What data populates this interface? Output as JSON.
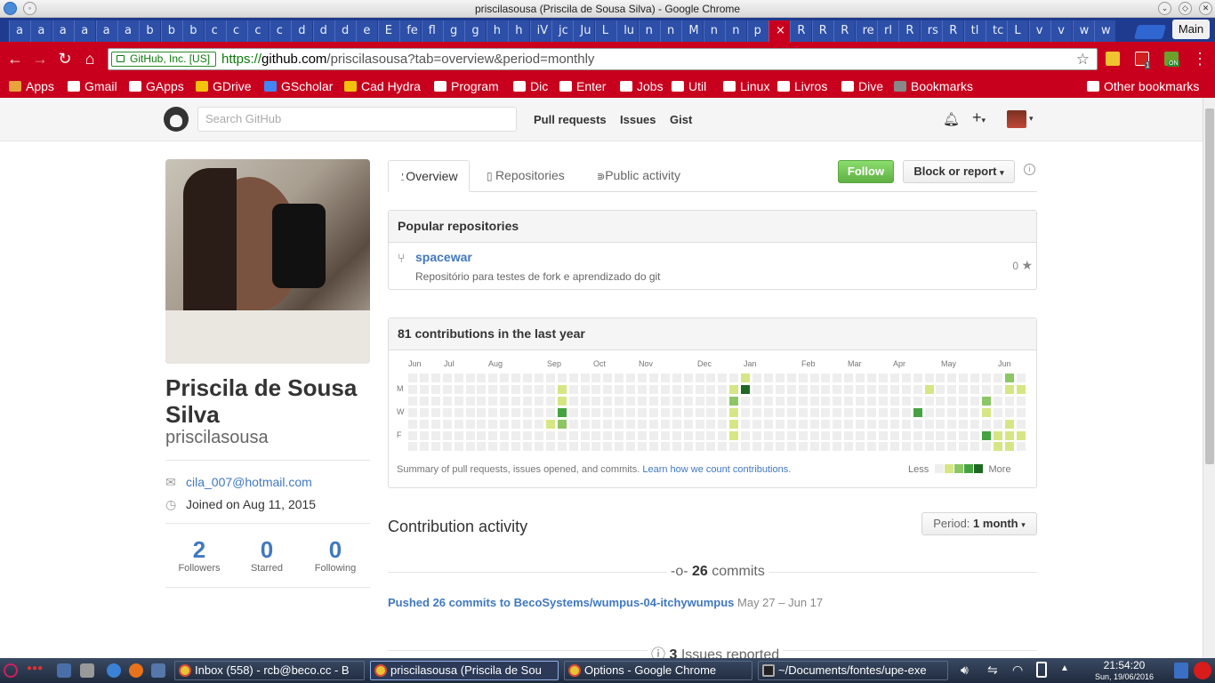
{
  "window": {
    "title": "priscilasousa (Priscila de Sousa Silva) - Google Chrome",
    "profile_label": "Main"
  },
  "tabs": [
    "a",
    "a",
    "a",
    "a",
    "a",
    "a",
    "b",
    "b",
    "b",
    "c",
    "c",
    "c",
    "c",
    "d",
    "d",
    "d",
    "e",
    "E",
    "fe",
    "fl",
    "g",
    "g",
    "h",
    "h",
    "iV",
    "jc",
    "Ju",
    "L",
    "lu",
    "n",
    "n",
    "M",
    "n",
    "n",
    "p",
    "×",
    "R",
    "R",
    "R",
    "re",
    "rl",
    "R",
    "rs",
    "R",
    "tl",
    "tc",
    "L",
    "v",
    "v",
    "w",
    "w"
  ],
  "active_tab_index": 35,
  "toolbar": {
    "security_label": "GitHub, Inc. [US]",
    "url_proto": "https://",
    "url_host": "github.com",
    "url_path": "/priscilasousa?tab=overview&period=monthly",
    "ext_badge_1": "1",
    "ext_badge_2": "ON"
  },
  "bookmarks": [
    {
      "label": "Apps",
      "icon": "apps-grid-icon",
      "color": "#e8a33d"
    },
    {
      "label": "Gmail",
      "icon": "gmail-icon",
      "color": "#ffffff"
    },
    {
      "label": "GApps",
      "icon": "google-icon",
      "color": "#ffffff"
    },
    {
      "label": "GDrive",
      "icon": "drive-icon",
      "color": "#f4c20d"
    },
    {
      "label": "GScholar",
      "icon": "scholar-icon",
      "color": "#4285f4"
    },
    {
      "label": "Cad Hydra",
      "icon": "drive-icon",
      "color": "#f4c20d"
    },
    {
      "label": "Program",
      "icon": "folder-icon",
      "color": "#ffffff"
    },
    {
      "label": "Dic",
      "icon": "folder-icon",
      "color": "#ffffff"
    },
    {
      "label": "Enter",
      "icon": "folder-icon",
      "color": "#ffffff"
    },
    {
      "label": "Jobs",
      "icon": "folder-icon",
      "color": "#ffffff"
    },
    {
      "label": "Util",
      "icon": "folder-icon",
      "color": "#ffffff"
    },
    {
      "label": "Linux",
      "icon": "folder-icon",
      "color": "#ffffff"
    },
    {
      "label": "Livros",
      "icon": "folder-icon",
      "color": "#ffffff"
    },
    {
      "label": "Dive",
      "icon": "folder-icon",
      "color": "#ffffff"
    },
    {
      "label": "Bookmarks",
      "icon": "star-icon",
      "color": "#888888"
    }
  ],
  "other_bookmarks": "Other bookmarks",
  "gh_header": {
    "search_placeholder": "Search GitHub",
    "nav": [
      "Pull requests",
      "Issues",
      "Gist"
    ]
  },
  "profile": {
    "fullname": "Priscila de Sousa Silva",
    "username": "priscilasousa",
    "email": "cila_007@hotmail.com",
    "joined": "Joined on Aug 11, 2015",
    "stats": [
      {
        "num": "2",
        "label": "Followers"
      },
      {
        "num": "0",
        "label": "Starred"
      },
      {
        "num": "0",
        "label": "Following"
      }
    ]
  },
  "profile_tabs": [
    "Overview",
    "Repositories",
    "Public activity"
  ],
  "actions": {
    "follow": "Follow",
    "block": "Block or report"
  },
  "popular": {
    "title": "Popular repositories",
    "repo_name": "spacewar",
    "repo_desc": "Repositório para testes de fork e aprendizado do git",
    "repo_stars": "0"
  },
  "contrib": {
    "title": "81 contributions in the last year",
    "months": [
      "Jun",
      "Jul",
      "Aug",
      "Sep",
      "Oct",
      "Nov",
      "Dec",
      "Jan",
      "Feb",
      "Mar",
      "Apr",
      "May",
      "Jun"
    ],
    "day_labels": [
      "M",
      "W",
      "F"
    ],
    "summary": "Summary of pull requests, issues opened, and commits.",
    "learn_link": "Learn how we count contributions.",
    "less": "Less",
    "more": "More",
    "colors": [
      "#eeeeee",
      "#d6e685",
      "#8cc665",
      "#44a340",
      "#1e6823"
    ],
    "cells": [
      {
        "week": 13,
        "day": 1,
        "level": 1
      },
      {
        "week": 13,
        "day": 2,
        "level": 1
      },
      {
        "week": 13,
        "day": 3,
        "level": 3
      },
      {
        "week": 13,
        "day": 4,
        "level": 2
      },
      {
        "week": 12,
        "day": 4,
        "level": 1
      },
      {
        "week": 28,
        "day": 1,
        "level": 1
      },
      {
        "week": 28,
        "day": 2,
        "level": 2
      },
      {
        "week": 28,
        "day": 3,
        "level": 1
      },
      {
        "week": 28,
        "day": 4,
        "level": 1
      },
      {
        "week": 28,
        "day": 5,
        "level": 1
      },
      {
        "week": 28,
        "day": 7,
        "level": 3
      },
      {
        "week": 29,
        "day": 0,
        "level": 1
      },
      {
        "week": 29,
        "day": 1,
        "level": 4
      },
      {
        "week": 45,
        "day": 1,
        "level": 1
      },
      {
        "week": 44,
        "day": 3,
        "level": 3
      },
      {
        "week": 50,
        "day": 2,
        "level": 2
      },
      {
        "week": 50,
        "day": 3,
        "level": 1
      },
      {
        "week": 50,
        "day": 5,
        "level": 3
      },
      {
        "week": 51,
        "day": 6,
        "level": 1
      },
      {
        "week": 52,
        "day": 0,
        "level": 2
      },
      {
        "week": 52,
        "day": 1,
        "level": 1
      },
      {
        "week": 52,
        "day": 4,
        "level": 1
      },
      {
        "week": 52,
        "day": 5,
        "level": 1
      },
      {
        "week": 52,
        "day": 6,
        "level": 1
      },
      {
        "week": 53,
        "day": 1,
        "level": 1
      },
      {
        "week": 53,
        "day": 5,
        "level": 1
      },
      {
        "week": 51,
        "day": 5,
        "level": 1
      }
    ]
  },
  "activity": {
    "title": "Contribution activity",
    "period_prefix": "Period:",
    "period_value": "1 month",
    "commits_count": "26",
    "commits_word": "commits",
    "pushed_text": "Pushed 26 commits to BecoSystems/wumpus-04-itchywumpus",
    "pushed_date": "May 27 – Jun 17",
    "issues_count": "3",
    "issues_word": "Issues reported"
  },
  "taskbar": {
    "tasks": [
      "Inbox (558) - rcb@beco.cc - B",
      "priscilasousa (Priscila de Sou",
      "Options - Google Chrome",
      "~/Documents/fontes/upe-exe"
    ],
    "time": "21:54:20",
    "date": "Sun, 19/06/2016"
  }
}
